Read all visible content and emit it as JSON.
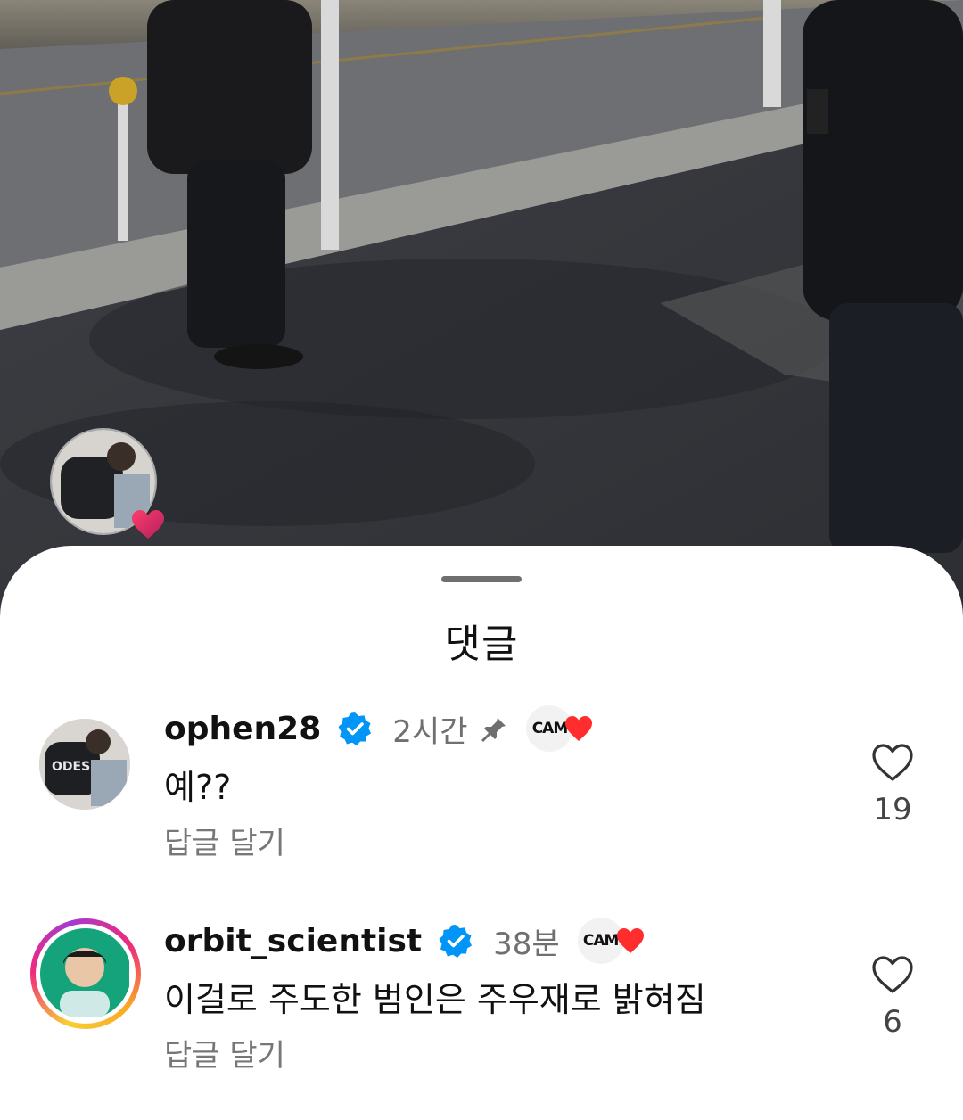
{
  "sheet": {
    "title": "댓글"
  },
  "comments": [
    {
      "username": "ophen28",
      "verified": true,
      "time": "2시간",
      "pinned": true,
      "badge_text": "CAM",
      "text": "예??",
      "reply_label": "답글 달기",
      "likes": "19",
      "story_ring": false
    },
    {
      "username": "orbit_scientist",
      "verified": true,
      "time": "38분",
      "pinned": false,
      "badge_text": "CAM",
      "text": "이걸로 주도한 범인은 주우재로 밝혀짐",
      "reply_label": "답글 달기",
      "likes": "6",
      "story_ring": true
    }
  ],
  "colors": {
    "verified": "#0095f6",
    "heart": "#ff2d2d",
    "secondary_text": "#777777"
  },
  "icons": [
    "verified-badge-icon",
    "pin-icon",
    "heart-outline-icon",
    "heart-filled-icon"
  ]
}
